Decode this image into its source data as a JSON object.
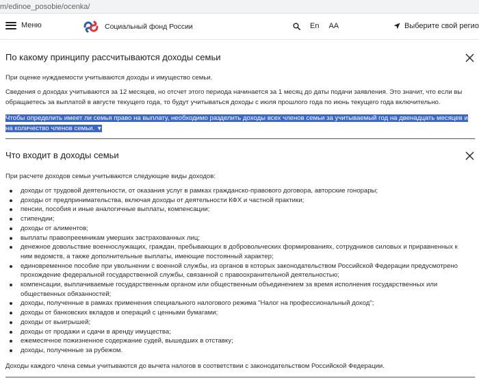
{
  "browser": {
    "url": "m/edinoe_posobie/ocenka/"
  },
  "header": {
    "menu_label": "Меню",
    "brand_name": "Социальный фонд России",
    "lang_label": "En",
    "font_size_label": "AA",
    "region_label": "Выберите свой регион",
    "colors": {
      "logo_blue": "#2a5fb0",
      "logo_red": "#e2313b"
    }
  },
  "section1": {
    "title": "По какому принципу рассчитываются доходы семьи",
    "p1": "При оценке нуждаемости учитываются доходы и имущество семьи.",
    "p2": "Сведения о доходах учитываются за 12 месяцев, но отсчет этого периода начинается за 1 месяц до даты подачи заявления. Это значит, что если вы обращаетесь за выплатой в августе текущего года, то будут учитываться доходы с июля прошлого года по июнь текущего года включительно.",
    "highlight": "Чтобы определить имеет ли семья право на выплату, необходимо разделить доходы всех членов семьи за учитываемый год на двенадцать месяцев и на количество членов семьи.",
    "highlight_caret": "▼",
    "highlight_color": "#3a67c9"
  },
  "section2": {
    "title": "Что входит в доходы семьи",
    "intro": "При расчете доходов семьи учитываются следующие виды доходов:",
    "items": [
      "доходы от трудовой деятельности, от оказания услуг в рамках гражданско-правового договора, авторские гонорары;",
      "доходы от предпринимательства, включая доходы от деятельности КФХ и частной практики;",
      "пенсии, пособия и иные аналогичные выплаты, компенсации;",
      "стипендии;",
      "доходы от алиментов;",
      "выплаты правопреемникам умерших застрахованных лиц;",
      "денежное довольствие военнослужащих, граждан, пребывающих в добровольческих формированиях, сотрудников силовых и приравненных к ним ведомств, а также дополнительные выплаты, имеющие постоянный характер;",
      "единовременное пособие при увольнении с военной службы, из органов в которых законодательством Российской Федерации предусмотрено прохождение федеральной государственной службы, связанной с правоохранительной деятельностью;",
      "компенсации, выплачиваемые государственным органом или общественным объединением за время исполнения государственных или общественных обязанностей;",
      "доходы, полученные в рамках применения специального налогового режима \"Налог на профессиональный доход\";",
      "доходы от банковских вкладов и операций с ценными бумагами;",
      "доходы от выигрышей;",
      "доходы от продажи и сдачи в аренду имущества;",
      "ежемесячное пожизненное содержание судей, вышедших в отставку;",
      "доходы, полученные за рубежом."
    ],
    "outro": "Доходы каждого члена семьи учитываются до вычета налогов в соответствии с законодательством Российской Федерации."
  }
}
